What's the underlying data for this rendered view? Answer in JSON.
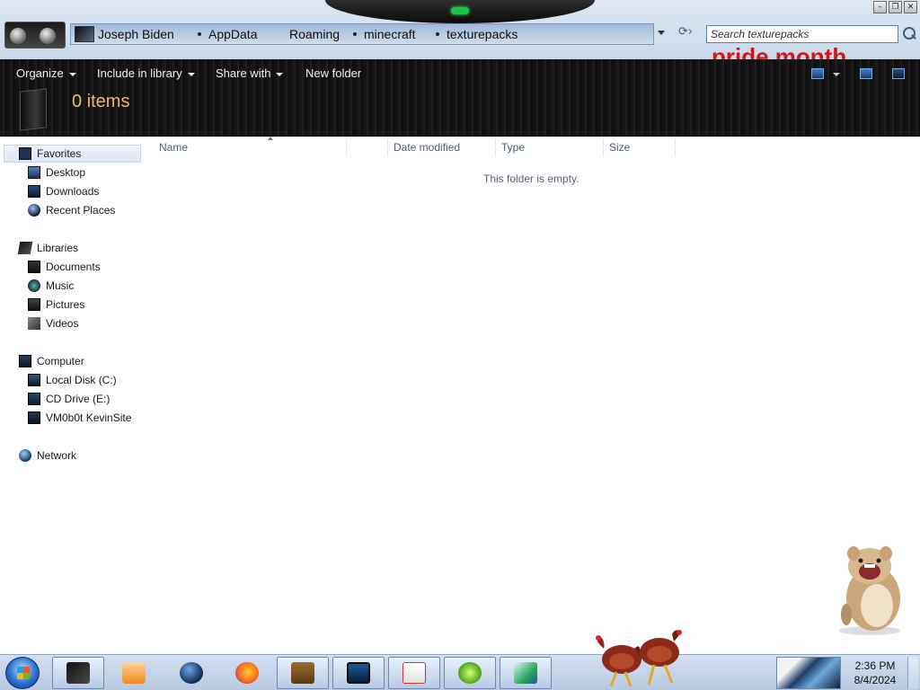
{
  "address_bar": {
    "breadcrumbs": [
      "Joseph Biden",
      "AppData",
      "Roaming",
      "minecraft",
      "texturepacks"
    ]
  },
  "search": {
    "placeholder": "Search texturepacks"
  },
  "banner_text": "pride month",
  "toolbar": {
    "organize": "Organize",
    "include_in_library": "Include in library",
    "share_with": "Share with",
    "new_folder": "New folder",
    "item_count": "0 items"
  },
  "nav": {
    "favorites": {
      "label": "Favorites",
      "items": [
        "Desktop",
        "Downloads",
        "Recent Places"
      ]
    },
    "libraries": {
      "label": "Libraries",
      "items": [
        "Documents",
        "Music",
        "Pictures",
        "Videos"
      ]
    },
    "computer": {
      "label": "Computer",
      "items": [
        "Local Disk (C:)",
        "CD Drive (E:)",
        "VM0b0t KevinSite"
      ]
    },
    "network": {
      "label": "Network"
    }
  },
  "columns": {
    "name": "Name",
    "date_modified": "Date modified",
    "type": "Type",
    "size": "Size"
  },
  "empty_message": "This folder is empty.",
  "taskbar": {
    "icons": [
      "file-explorer-icon",
      "media-player-icon",
      "globe-browser-icon",
      "firefox-icon",
      "bonzi-box-icon",
      "tablet-icon",
      "java-icon",
      "lime-icon",
      "onenote-icon"
    ],
    "active_index": 0,
    "time": "2:36 PM",
    "date": "8/4/2024"
  },
  "colors": {
    "toolbar_bg": "#141414",
    "item_count": "#f0b76b",
    "banner_red": "#d81414",
    "notch_led": "#19c447"
  }
}
